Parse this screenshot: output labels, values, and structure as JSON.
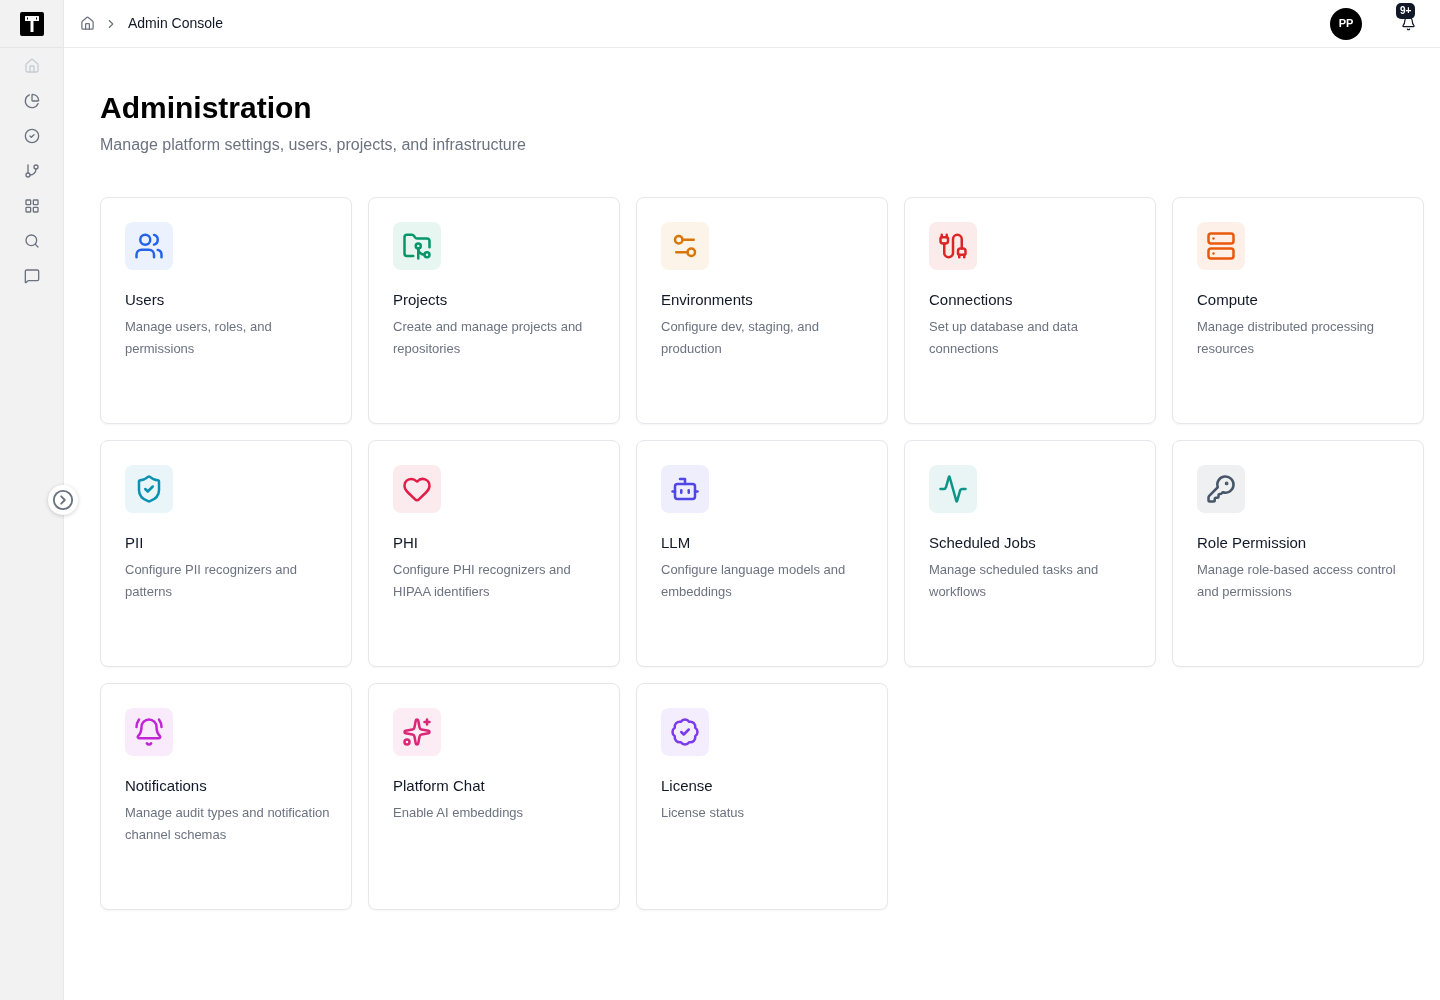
{
  "sidebar": {
    "items": [
      {
        "disabled": true
      },
      {
        "disabled": false
      },
      {
        "disabled": false
      },
      {
        "disabled": false
      },
      {
        "disabled": false
      },
      {
        "disabled": false
      },
      {
        "disabled": false
      }
    ]
  },
  "header": {
    "breadcrumb": "Admin Console",
    "avatar": "PP",
    "notification_badge": "9+"
  },
  "page": {
    "title": "Administration",
    "subtitle": "Manage platform settings, users, projects, and infrastructure"
  },
  "cards": [
    {
      "title": "Users",
      "description": "Manage users, roles, and permissions",
      "color": "#2563eb"
    },
    {
      "title": "Projects",
      "description": "Create and manage projects and repositories",
      "color": "#059669"
    },
    {
      "title": "Environments",
      "description": "Configure dev, staging, and production",
      "color": "#d97706"
    },
    {
      "title": "Connections",
      "description": "Set up database and data connections",
      "color": "#dc2626"
    },
    {
      "title": "Compute",
      "description": "Manage distributed processing resources",
      "color": "#ea580c"
    },
    {
      "title": "PII",
      "description": "Configure PII recognizers and patterns",
      "color": "#0891b2"
    },
    {
      "title": "PHI",
      "description": "Configure PHI recognizers and HIPAA identifiers",
      "color": "#e11d48"
    },
    {
      "title": "LLM",
      "description": "Configure language models and embeddings",
      "color": "#4f46e5"
    },
    {
      "title": "Scheduled Jobs",
      "description": "Manage scheduled tasks and workflows",
      "color": "#0d9488"
    },
    {
      "title": "Role Permission",
      "description": "Manage role-based access control and permissions",
      "color": "#475569"
    },
    {
      "title": "Notifications",
      "description": "Manage audit types and notification channel schemas",
      "color": "#c026d3"
    },
    {
      "title": "Platform Chat",
      "description": "Enable AI embeddings",
      "color": "#db2777"
    },
    {
      "title": "License",
      "description": "License status",
      "color": "#7c3aed"
    }
  ]
}
